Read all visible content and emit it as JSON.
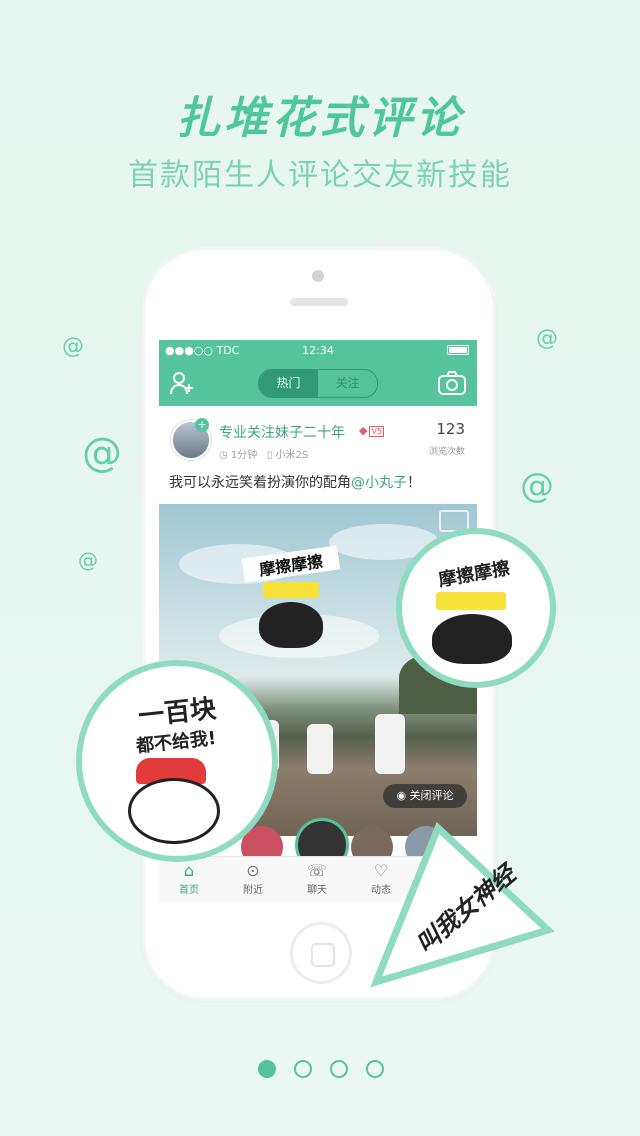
{
  "headline": "扎堆花式评论",
  "subheadline": "首款陌生人评论交友新技能",
  "status": {
    "carrier": "●●●○○ TDC",
    "time": "12:34"
  },
  "navbar": {
    "tabs": [
      "热门",
      "关注"
    ],
    "active_tab": "热门"
  },
  "post": {
    "username": "专业关注妹子二十年",
    "badge": "V5",
    "time": "1分钟",
    "device": "小米2S",
    "views": "123",
    "views_label": "浏览次数",
    "text_before": "我可以永远笑着扮演你的配角",
    "mention": "@小丸子",
    "text_after": "！",
    "close_comments": "关闭评论"
  },
  "tabbar": [
    {
      "label": "首页",
      "icon": "home-icon",
      "active": true
    },
    {
      "label": "附近",
      "icon": "location-icon",
      "active": false
    },
    {
      "label": "聊天",
      "icon": "chat-icon",
      "active": false
    },
    {
      "label": "动态",
      "icon": "heart-icon",
      "active": false
    }
  ],
  "stickers": {
    "left_top": "一百块",
    "left_bottom": "都不给我!",
    "right": "摩擦摩擦",
    "photo_sticker": "摩擦摩擦",
    "triangle": "叫我女神经"
  },
  "pagination": {
    "count": 4,
    "active": 0
  },
  "colors": {
    "accent": "#55c49c",
    "accent_dark": "#2f9a75",
    "text_green": "#3aa67f"
  }
}
